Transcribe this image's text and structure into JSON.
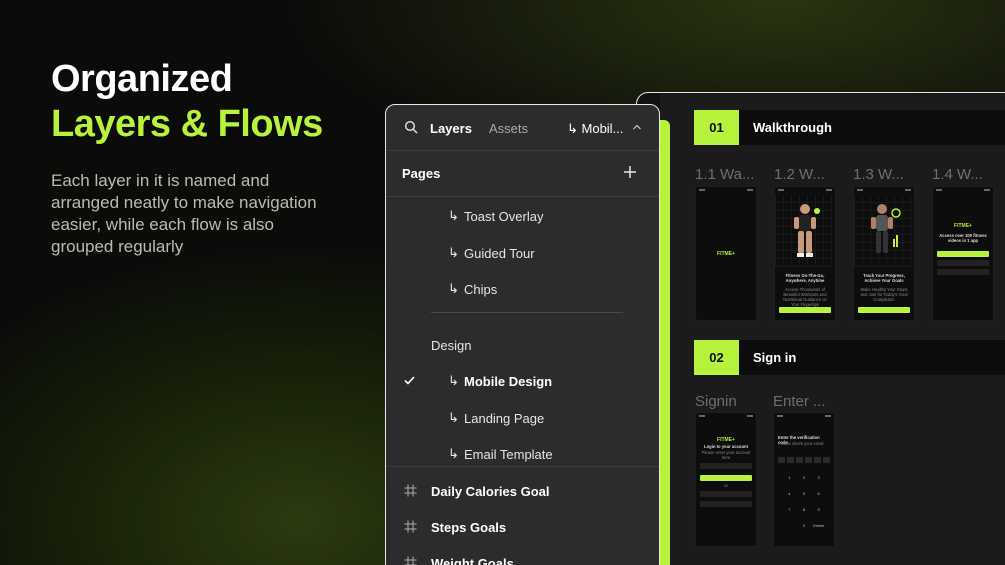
{
  "hero": {
    "title_line1": "Organized",
    "title_line2": "Layers & Flows",
    "body": "Each layer in it is named and arranged neatly to make navigation easier, while each flow is also grouped regularly"
  },
  "colors": {
    "accent": "#b7f23c",
    "background": "#0b0c0a",
    "panel": "#2c2c2c"
  },
  "panel": {
    "tabs": {
      "layers": "Layers",
      "assets": "Assets",
      "page": "↳ Mobil..."
    },
    "pages_title": "Pages",
    "pages": [
      {
        "label": "Toast Overlay",
        "prefix": "↳"
      },
      {
        "label": "Guided Tour",
        "prefix": "↳"
      },
      {
        "label": "Chips",
        "prefix": "↳"
      },
      {
        "label": "Design",
        "prefix": ""
      },
      {
        "label": "Mobile Design",
        "prefix": "↳",
        "selected": true
      },
      {
        "label": "Landing Page",
        "prefix": "↳"
      },
      {
        "label": "Email Template",
        "prefix": "↳"
      }
    ],
    "layers": [
      "Daily Calories Goal",
      "Steps Goals",
      "Weight Goals"
    ]
  },
  "canvas": {
    "sections": [
      {
        "number": "01",
        "name": "Walkthrough",
        "frames": [
          "1.1 Wa...",
          "1.2 W...",
          "1.3 W...",
          "1.4 W..."
        ],
        "screens": {
          "logo": "FITME+",
          "s2_title": "Fitness On-The-Go, Anywhere, Anytime",
          "s2_body": "Access Thousands of Beautiful Workouts and Nutritional Guidance on Your Fingertips",
          "s3_title": "Track Your Progress, Achieve Your Goals",
          "s3_body": "Make Healthy Your Steps and Just for Today's Goal Completion",
          "s4_title": "Access over 100 fitness videos in 1 app",
          "btn": "Continue",
          "s4_btn1": "Continue with email",
          "s4_btn2": "Login with Google",
          "s4_btn3": "Login with Apple"
        }
      },
      {
        "number": "02",
        "name": "Sign in",
        "frames": [
          "Signin",
          "Enter ..."
        ],
        "screens": {
          "login_title": "Login to your account",
          "login_sub": "Please enter your account here",
          "email_ph": "Enter your email",
          "btn": "Continue",
          "or": "or",
          "google": "Login with Google",
          "apple": "Login with Apple",
          "code_title": "Enter the verification code",
          "code_sub": "Please check your email",
          "keys": [
            "1",
            "2",
            "3",
            "4",
            "5",
            "6",
            "7",
            "8",
            "9",
            "",
            "0",
            "Delete"
          ]
        }
      }
    ]
  }
}
